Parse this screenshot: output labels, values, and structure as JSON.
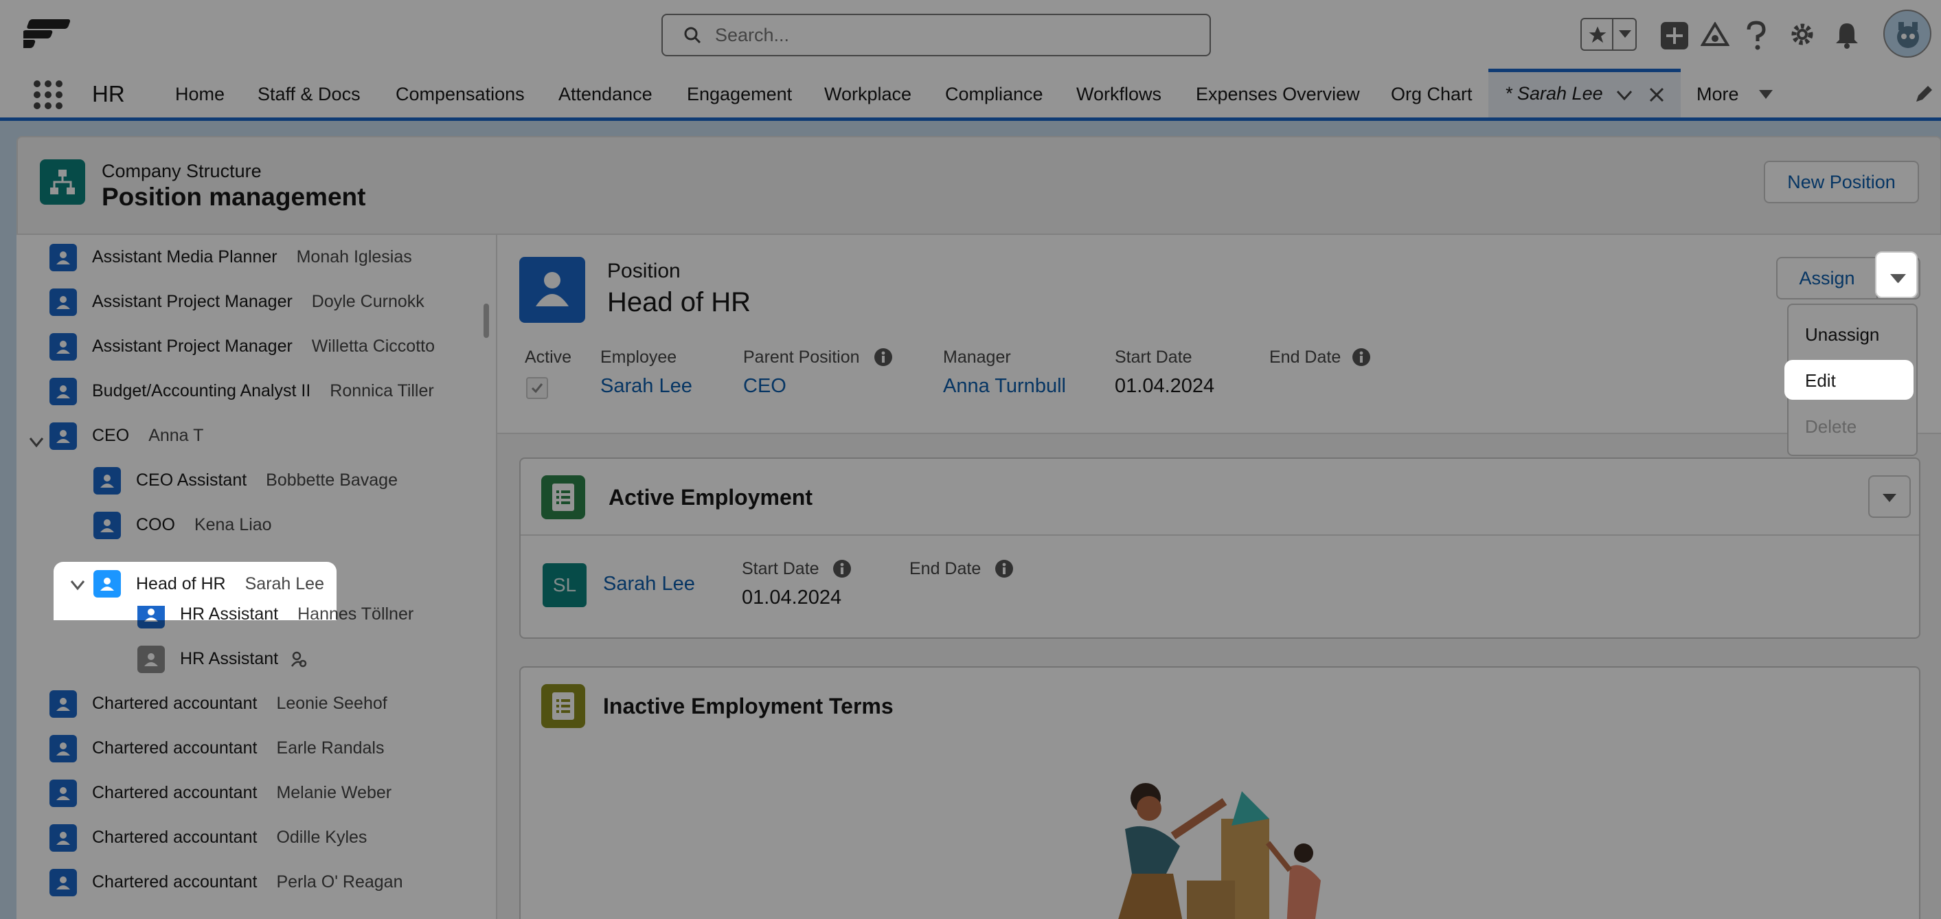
{
  "search": {
    "placeholder": "Search..."
  },
  "nav": {
    "app_name": "HR",
    "tabs": [
      "Home",
      "Staff & Docs",
      "Compensations",
      "Attendance",
      "Engagement",
      "Workplace",
      "Compliance",
      "Workflows",
      "Expenses Overview",
      "Org Chart"
    ],
    "active_tab": "* Sarah Lee",
    "more": "More"
  },
  "header": {
    "subtitle": "Company Structure",
    "title": "Position management",
    "new_position": "New Position"
  },
  "tree": [
    {
      "title": "Assistant Media Planner",
      "name": "Monah Iglesias"
    },
    {
      "title": "Assistant Project Manager",
      "name": "Doyle Curnokk"
    },
    {
      "title": "Assistant Project Manager",
      "name": "Willetta Ciccotto"
    },
    {
      "title": "Budget/Accounting Analyst II",
      "name": "Ronnica Tiller"
    },
    {
      "title": "CEO",
      "name": "Anna T"
    },
    {
      "title": "CEO Assistant",
      "name": "Bobbette Bavage"
    },
    {
      "title": "COO",
      "name": "Kena Liao"
    },
    {
      "title": "Head of HR",
      "name": "Sarah Lee"
    },
    {
      "title": "HR Assistant",
      "name": "Hannes Töllner"
    },
    {
      "title": "HR Assistant",
      "name": ""
    },
    {
      "title": "Chartered accountant",
      "name": "Leonie Seehof"
    },
    {
      "title": "Chartered accountant",
      "name": "Earle Randals"
    },
    {
      "title": "Chartered accountant",
      "name": "Melanie Weber"
    },
    {
      "title": "Chartered accountant",
      "name": "Odille Kyles"
    },
    {
      "title": "Chartered accountant",
      "name": "Perla O' Reagan"
    }
  ],
  "position": {
    "label": "Position",
    "title": "Head of HR",
    "assign": "Assign",
    "fields": {
      "active": "Active",
      "employee": "Employee",
      "parent": "Parent Position",
      "manager": "Manager",
      "start": "Start Date",
      "end": "End Date"
    },
    "values": {
      "employee": "Sarah Lee",
      "parent": "CEO",
      "manager": "Anna Turnbull",
      "start": "01.04.2024",
      "end": ""
    },
    "menu": [
      "Unassign",
      "Edit",
      "Delete"
    ]
  },
  "active_employment": {
    "title": "Active Employment",
    "initials": "SL",
    "name": "Sarah Lee",
    "start_label": "Start Date",
    "end_label": "End Date",
    "start": "01.04.2024",
    "end": ""
  },
  "inactive": {
    "title": "Inactive Employment Terms"
  },
  "colors": {
    "brand_blue": "#1b66c9",
    "teal": "#0b827c",
    "link": "#0b5cab"
  }
}
